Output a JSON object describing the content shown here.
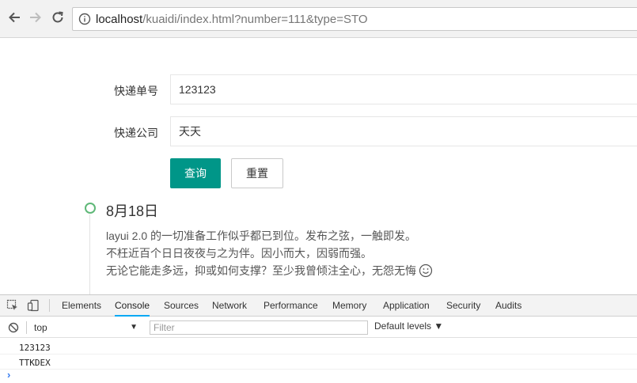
{
  "browser": {
    "url_host": "localhost",
    "url_rest": "/kuaidi/index.html?number=111&type=STO"
  },
  "form": {
    "number_label": "快递单号",
    "number_value": "123123",
    "company_label": "快递公司",
    "company_value": "天天",
    "query_button": "查询",
    "reset_button": "重置"
  },
  "timeline": {
    "date": "8月18日",
    "lines": [
      "layui 2.0 的一切准备工作似乎都已到位。发布之弦，一触即发。",
      "不枉近百个日日夜夜与之为伴。因小而大，因弱而强。",
      "无论它能走多远，抑或如何支撑？至少我曾倾注全心，无怨无悔"
    ]
  },
  "devtools": {
    "tabs": [
      "Elements",
      "Console",
      "Sources",
      "Network",
      "Performance",
      "Memory",
      "Application",
      "Security",
      "Audits"
    ],
    "active_tab": "Console",
    "context": "top",
    "filter_placeholder": "Filter",
    "levels": "Default levels ▼",
    "console_lines": [
      "123123",
      "TTKDEX"
    ],
    "accent_color": "#03a9f4"
  },
  "colors": {
    "primary_button": "#009688",
    "timeline_dot": "#5fb878"
  }
}
